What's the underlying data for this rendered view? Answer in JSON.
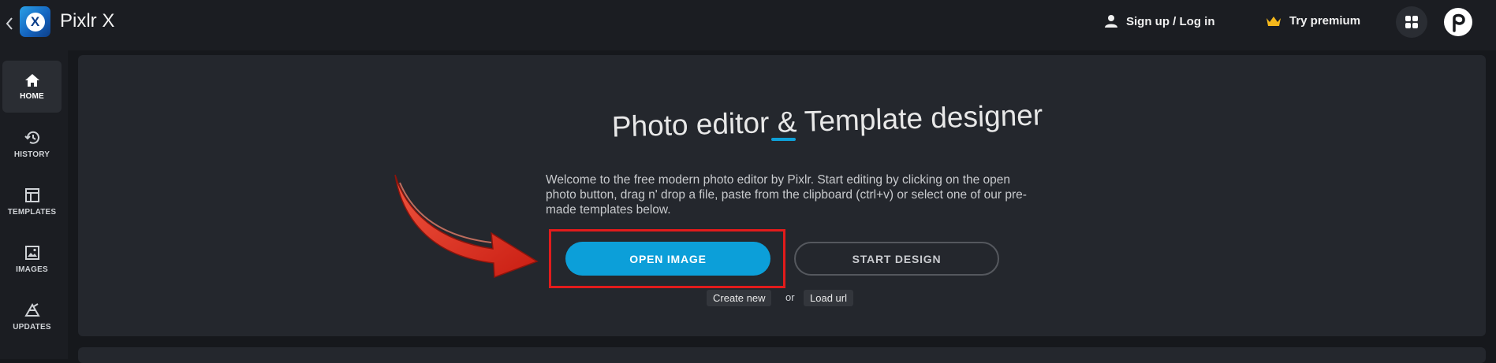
{
  "header": {
    "app_name": "Pixlr X",
    "logo_letter": "X",
    "signin_label": "Sign up / Log in",
    "premium_label": "Try premium"
  },
  "sidebar": {
    "items": [
      {
        "label": "HOME",
        "icon": "home-icon",
        "active": true
      },
      {
        "label": "HISTORY",
        "icon": "history-icon",
        "active": false
      },
      {
        "label": "TEMPLATES",
        "icon": "templates-icon",
        "active": false
      },
      {
        "label": "IMAGES",
        "icon": "image-icon",
        "active": false
      },
      {
        "label": "UPDATES",
        "icon": "updates-icon",
        "active": false
      }
    ]
  },
  "main": {
    "headline": "Photo editor & Template designer",
    "welcome_text": "Welcome to the free modern photo editor by Pixlr. Start editing by clicking on the open photo button, drag n' drop a file, paste from the clipboard (ctrl+v) or select one of our pre-made templates below.",
    "open_button": "OPEN IMAGE",
    "start_button": "START DESIGN",
    "create_link": "Create new",
    "or_text": "or",
    "load_link": "Load url"
  },
  "colors": {
    "accent": "#0c9fd9",
    "highlight": "#e21b1b",
    "premium_crown": "#f5b81c",
    "arrow": "#e8321e"
  }
}
